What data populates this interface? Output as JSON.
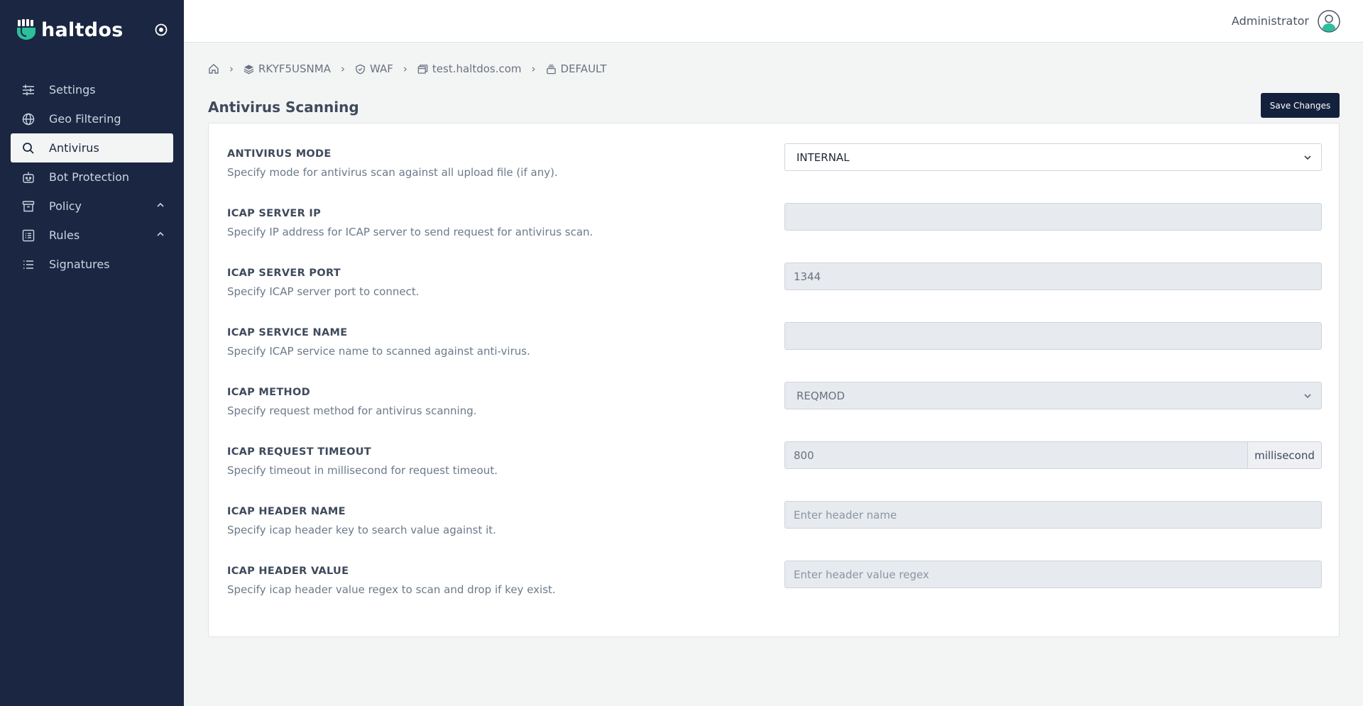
{
  "brand": {
    "name": "haltdos"
  },
  "header": {
    "user_name": "Administrator"
  },
  "sidebar": {
    "items": [
      {
        "label": "Settings",
        "icon": "sliders-icon"
      },
      {
        "label": "Geo Filtering",
        "icon": "globe-icon"
      },
      {
        "label": "Antivirus",
        "icon": "search-icon",
        "active": true
      },
      {
        "label": "Bot Protection",
        "icon": "robot-icon"
      },
      {
        "label": "Policy",
        "icon": "archive-icon",
        "expandable": true
      },
      {
        "label": "Rules",
        "icon": "list-box-icon",
        "expandable": true
      },
      {
        "label": "Signatures",
        "icon": "list-icon"
      }
    ]
  },
  "breadcrumb": {
    "items": [
      {
        "label": "",
        "icon": "home-icon"
      },
      {
        "label": "RKYF5USNMA",
        "icon": "layers-icon"
      },
      {
        "label": "WAF",
        "icon": "shield-icon"
      },
      {
        "label": "test.haltdos.com",
        "icon": "window-icon"
      },
      {
        "label": "DEFAULT",
        "icon": "stack-icon"
      }
    ]
  },
  "page": {
    "title": "Antivirus Scanning",
    "save_label": "Save Changes"
  },
  "form": {
    "antivirus_mode": {
      "label": "ANTIVIRUS MODE",
      "desc": "Specify mode for antivirus scan against all upload file (if any).",
      "value": "INTERNAL"
    },
    "icap_server_ip": {
      "label": "ICAP SERVER IP",
      "desc": "Specify IP address for ICAP server to send request for antivirus scan.",
      "value": ""
    },
    "icap_server_port": {
      "label": "ICAP SERVER PORT",
      "desc": "Specify ICAP server port to connect.",
      "value": "1344"
    },
    "icap_service_name": {
      "label": "ICAP SERVICE NAME",
      "desc": "Specify ICAP service name to scanned against anti-virus.",
      "value": ""
    },
    "icap_method": {
      "label": "ICAP METHOD",
      "desc": "Specify request method for antivirus scanning.",
      "value": "REQMOD"
    },
    "icap_request_timeout": {
      "label": "ICAP REQUEST TIMEOUT",
      "desc": "Specify timeout in millisecond for request timeout.",
      "value": "800",
      "unit": "millisecond"
    },
    "icap_header_name": {
      "label": "ICAP HEADER NAME",
      "desc": "Specify icap header key to search value against it.",
      "placeholder": "Enter header name"
    },
    "icap_header_value": {
      "label": "ICAP HEADER VALUE",
      "desc": "Specify icap header value regex to scan and drop if key exist.",
      "placeholder": "Enter header value regex"
    }
  },
  "colors": {
    "sidebar_bg": "#1b2642",
    "brand_accent": "#2bbf9b",
    "button_bg": "#14213d"
  }
}
